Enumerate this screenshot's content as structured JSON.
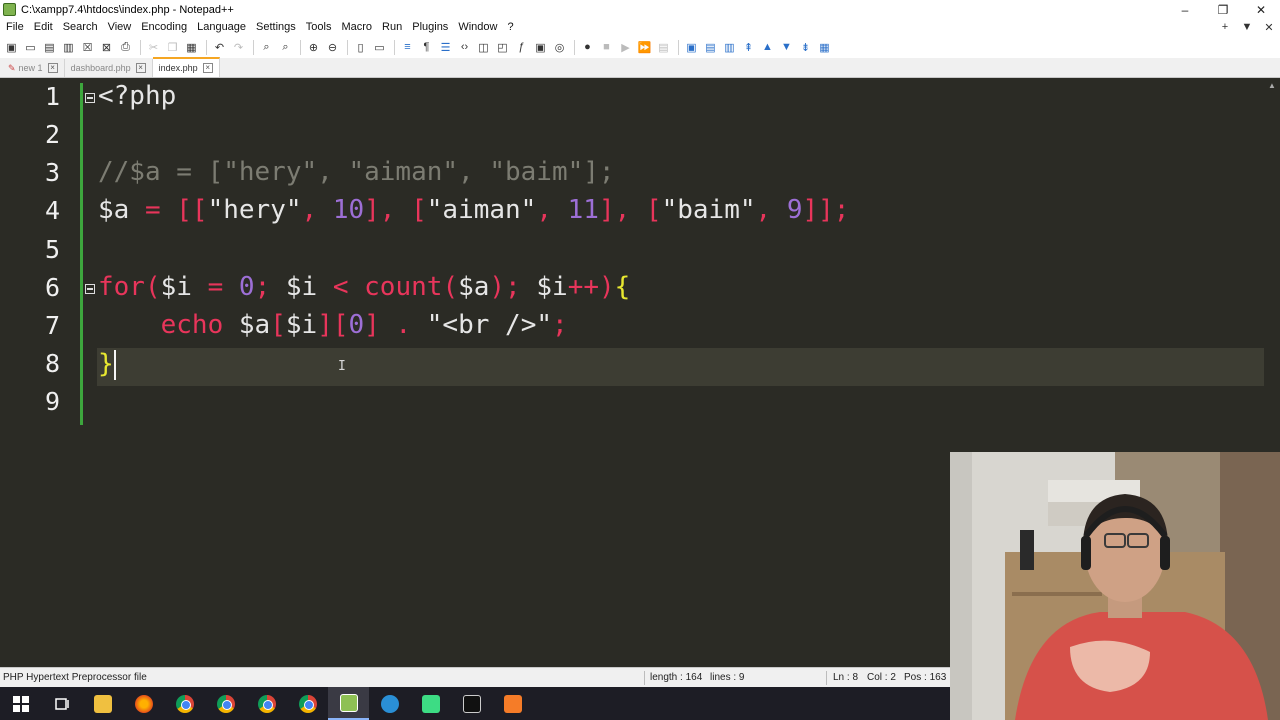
{
  "window": {
    "title": "C:\\xampp7.4\\htdocs\\index.php - Notepad++",
    "minimize": "–",
    "restore": "❐",
    "close": "✕"
  },
  "menu": {
    "items": [
      "File",
      "Edit",
      "Search",
      "View",
      "Encoding",
      "Language",
      "Settings",
      "Tools",
      "Macro",
      "Run",
      "Plugins",
      "Window",
      "?"
    ],
    "right": [
      "+",
      "▼",
      "✕"
    ]
  },
  "tabs": [
    {
      "label": "new 1",
      "active": false
    },
    {
      "label": "dashboard.php",
      "active": false
    },
    {
      "label": "index.php",
      "active": true
    }
  ],
  "editor": {
    "line_numbers": [
      "1",
      "2",
      "3",
      "4",
      "5",
      "6",
      "7",
      "8",
      "9"
    ],
    "current_line": 8,
    "lines": {
      "l1": {
        "tag": "<?php"
      },
      "l3": {
        "comment": "//$a = [\"hery\", \"aiman\", \"baim\"];"
      },
      "l4": {
        "var": "$a",
        "eq": " = ",
        "open": "[[",
        "s1": "\"hery\"",
        "c1": ", ",
        "n1": "10",
        "close1": "], [",
        "s2": "\"aiman\"",
        "c2": ", ",
        "n2": "11",
        "close2": "], [",
        "s3": "\"baim\"",
        "c3": ", ",
        "n3": "9",
        "close3": "]];"
      },
      "l6": {
        "kw": "for",
        "p1": "(",
        "v1": "$i",
        "eq": " = ",
        "n0": "0",
        "semi1": "; ",
        "v2": "$i",
        "lt": " < ",
        "fn": "count",
        "p2": "(",
        "v3": "$a",
        "p3": "); ",
        "v4": "$i",
        "inc": "++",
        "p4": ")",
        "brace": "{"
      },
      "l7": {
        "indent": "    ",
        "kw": "echo",
        "v1": " $a",
        "b1": "[",
        "v2": "$i",
        "b2": "][",
        "n0": "0",
        "b3": "]",
        "dot": " . ",
        "str": "\"<br />\"",
        "semi": ";"
      },
      "l8": {
        "brace": "}"
      }
    }
  },
  "status": {
    "filetype": "PHP Hypertext Preprocessor file",
    "length": "length : 164",
    "lines": "lines : 9",
    "ln": "Ln : 8",
    "col": "Col : 2",
    "pos": "Pos : 163"
  },
  "colors": {
    "editor_bg": "#2b2b25",
    "keyword": "#e8355b",
    "number": "#9d6fd6",
    "brace": "#e8e830",
    "comment": "#7c7c72",
    "fold_line": "#3da63d",
    "tab_accent": "#f5a623"
  },
  "taskbar_icons": [
    "windows-start-icon",
    "task-view-icon",
    "file-explorer-icon",
    "firefox-icon",
    "chrome-icon",
    "chrome-icon",
    "chrome-icon",
    "chrome-icon",
    "notepadpp-icon",
    "vscode-icon",
    "android-studio-icon",
    "terminal-icon",
    "xampp-icon"
  ]
}
